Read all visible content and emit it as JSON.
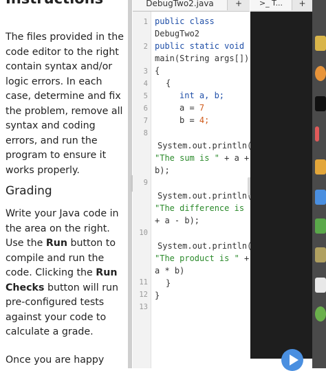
{
  "instructions": {
    "heading": "Instructions",
    "para1": "The files provided in the code editor to the right contain syntax and/or logic errors. In each case, determine and fix the problem, remove all syntax and coding errors, and run the program to ensure it works properly.",
    "grading_heading": "Grading",
    "para2_pre": "Write your Java code in the area on the right. Use the ",
    "para2_run": "Run",
    "para2_mid": " button to compile and run the code. Clicking the ",
    "para2_runchecks": "Run Checks",
    "para2_post": " button will run pre-configured tests against your code to calculate a grade.",
    "para3": "Once you are happy with"
  },
  "editor": {
    "tab_name": "DebugTwo2.java",
    "tab_add": "+",
    "line_numbers": [
      "1",
      "2",
      "3",
      "4",
      "5",
      "6",
      "7",
      "8",
      "9",
      "10",
      "11",
      "12",
      "13"
    ],
    "code": {
      "l1_kw": "public class",
      "l1_name": "DebugTwo2",
      "l2_kw": "public static void",
      "l2_name": "main(String args[])",
      "l3": "{",
      "l4": "{",
      "l5": "int a, b;",
      "l6_pre": "a = ",
      "l6_num": "7",
      "l7_pre": "b = ",
      "l7_num": "4;",
      "l8_a": "System.out.println(",
      "l8_str": "\"The sum is \"",
      "l8_rest": " + a +",
      "l8_c": "b);",
      "l9_a": "System.out.println(",
      "l9_str": "\"The difference is \"",
      "l9_c": "+ a - b);",
      "l10_a": "System.out.println(",
      "l10_str": "\"The product is \"",
      "l10_rest": " +",
      "l10_c": "a * b)",
      "l11": "}",
      "l12": "}"
    }
  },
  "terminal": {
    "tab_label": ">_ T...",
    "tab_add": "+"
  },
  "colors": {
    "keyword": "#1f4fa8",
    "string": "#2b8a2b",
    "number": "#d05a1a",
    "run_button": "#4a8fe0"
  },
  "icons": [
    "run-icon"
  ]
}
